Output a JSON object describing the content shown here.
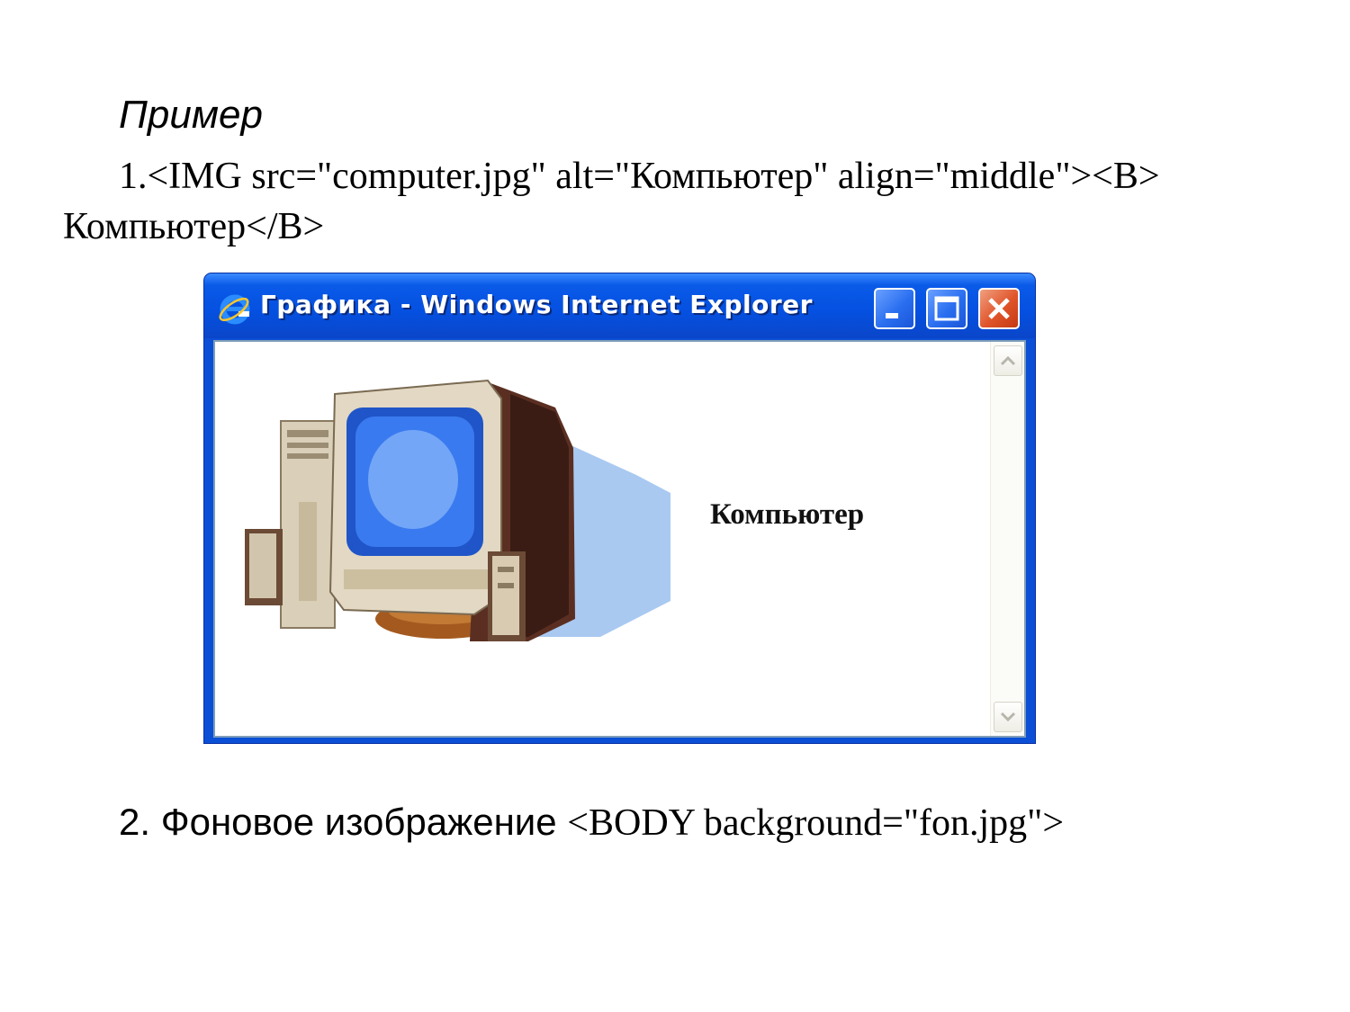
{
  "slide": {
    "heading": "Пример",
    "line1": "1.<IMG src=\"computer.jpg\" alt=\"Компьютер\" align=\"middle\"><B> Компьютер</B>",
    "item2_label": "2. Фоновое изображение ",
    "item2_code": "<BODY background=\"fon.jpg\">"
  },
  "window": {
    "title": "Графика - Windows Internet Explorer",
    "caption": "Компьютер",
    "icons": {
      "app": "ie-logo-icon",
      "minimize": "minimize-icon",
      "maximize": "maximize-icon",
      "close": "close-icon",
      "scroll_up": "scroll-up-arrow-icon",
      "scroll_down": "scroll-down-arrow-icon"
    }
  },
  "colors": {
    "titlebar": "#0550e0",
    "close_button": "#e0542a",
    "monitor_screen": "#3a7af0"
  }
}
